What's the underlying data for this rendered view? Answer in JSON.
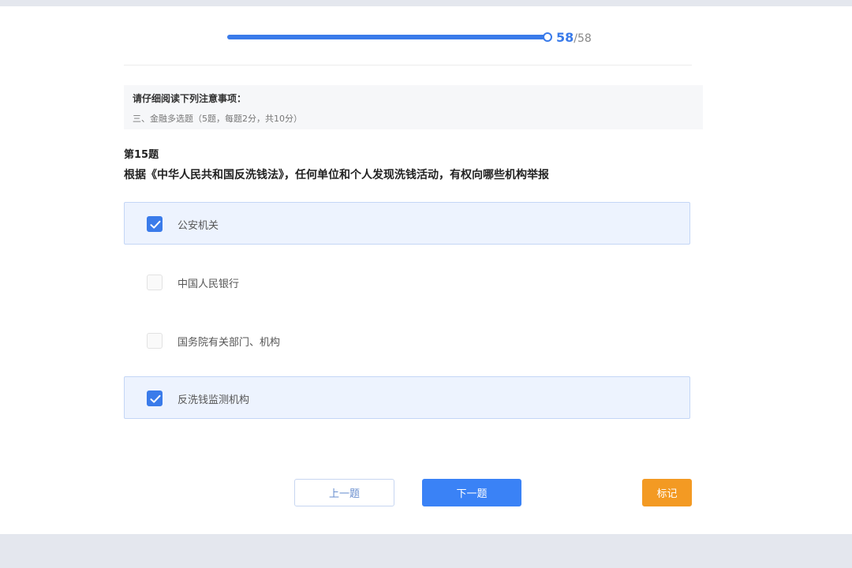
{
  "progress": {
    "current": "58",
    "separator": "/",
    "total": "58",
    "fraction": 1.0
  },
  "notice": {
    "title": "请仔细阅读下列注意事项：",
    "text": "三、金融多选题（5题，每题2分，共10分）"
  },
  "question": {
    "number": "第15题",
    "text": "根据《中华人民共和国反洗钱法》，任何单位和个人发现洗钱活动，有权向哪些机构举报"
  },
  "options": [
    {
      "label": "公安机关",
      "checked": true
    },
    {
      "label": "中国人民银行",
      "checked": false
    },
    {
      "label": "国务院有关部门、机构",
      "checked": false
    },
    {
      "label": "反洗钱监测机构",
      "checked": true
    }
  ],
  "buttons": {
    "prev": "上一题",
    "next": "下一题",
    "mark": "标记"
  },
  "colors": {
    "accent": "#3a7bea",
    "mark": "#f39a23",
    "checked_bg": "#edf3fe"
  },
  "icons": {
    "check": "check-icon"
  }
}
